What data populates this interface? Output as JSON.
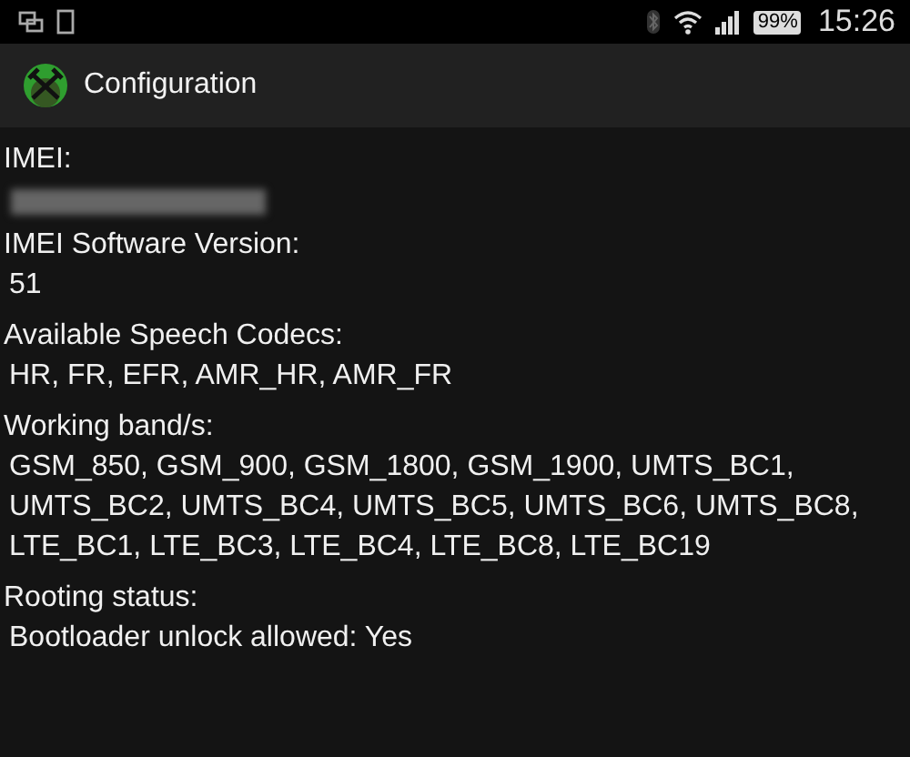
{
  "status_bar": {
    "battery": "99%",
    "time": "15:26"
  },
  "action_bar": {
    "title": "Configuration"
  },
  "sections": [
    {
      "label": "IMEI:",
      "kind": "redacted"
    },
    {
      "label": "IMEI Software Version:",
      "kind": "text",
      "lines": [
        "51"
      ]
    },
    {
      "label": "Available Speech Codecs:",
      "kind": "text",
      "lines": [
        "HR, FR, EFR, AMR_HR, AMR_FR"
      ]
    },
    {
      "label": "Working band/s:",
      "kind": "text",
      "lines": [
        "GSM_850, GSM_900, GSM_1800, GSM_1900, UMTS_BC1,",
        "UMTS_BC2, UMTS_BC4, UMTS_BC5, UMTS_BC6, UMTS_BC8,",
        "LTE_BC1, LTE_BC3, LTE_BC4, LTE_BC8, LTE_BC19"
      ]
    },
    {
      "label": "Rooting status:",
      "kind": "text",
      "lines": [
        "Bootloader unlock allowed: Yes"
      ]
    }
  ]
}
